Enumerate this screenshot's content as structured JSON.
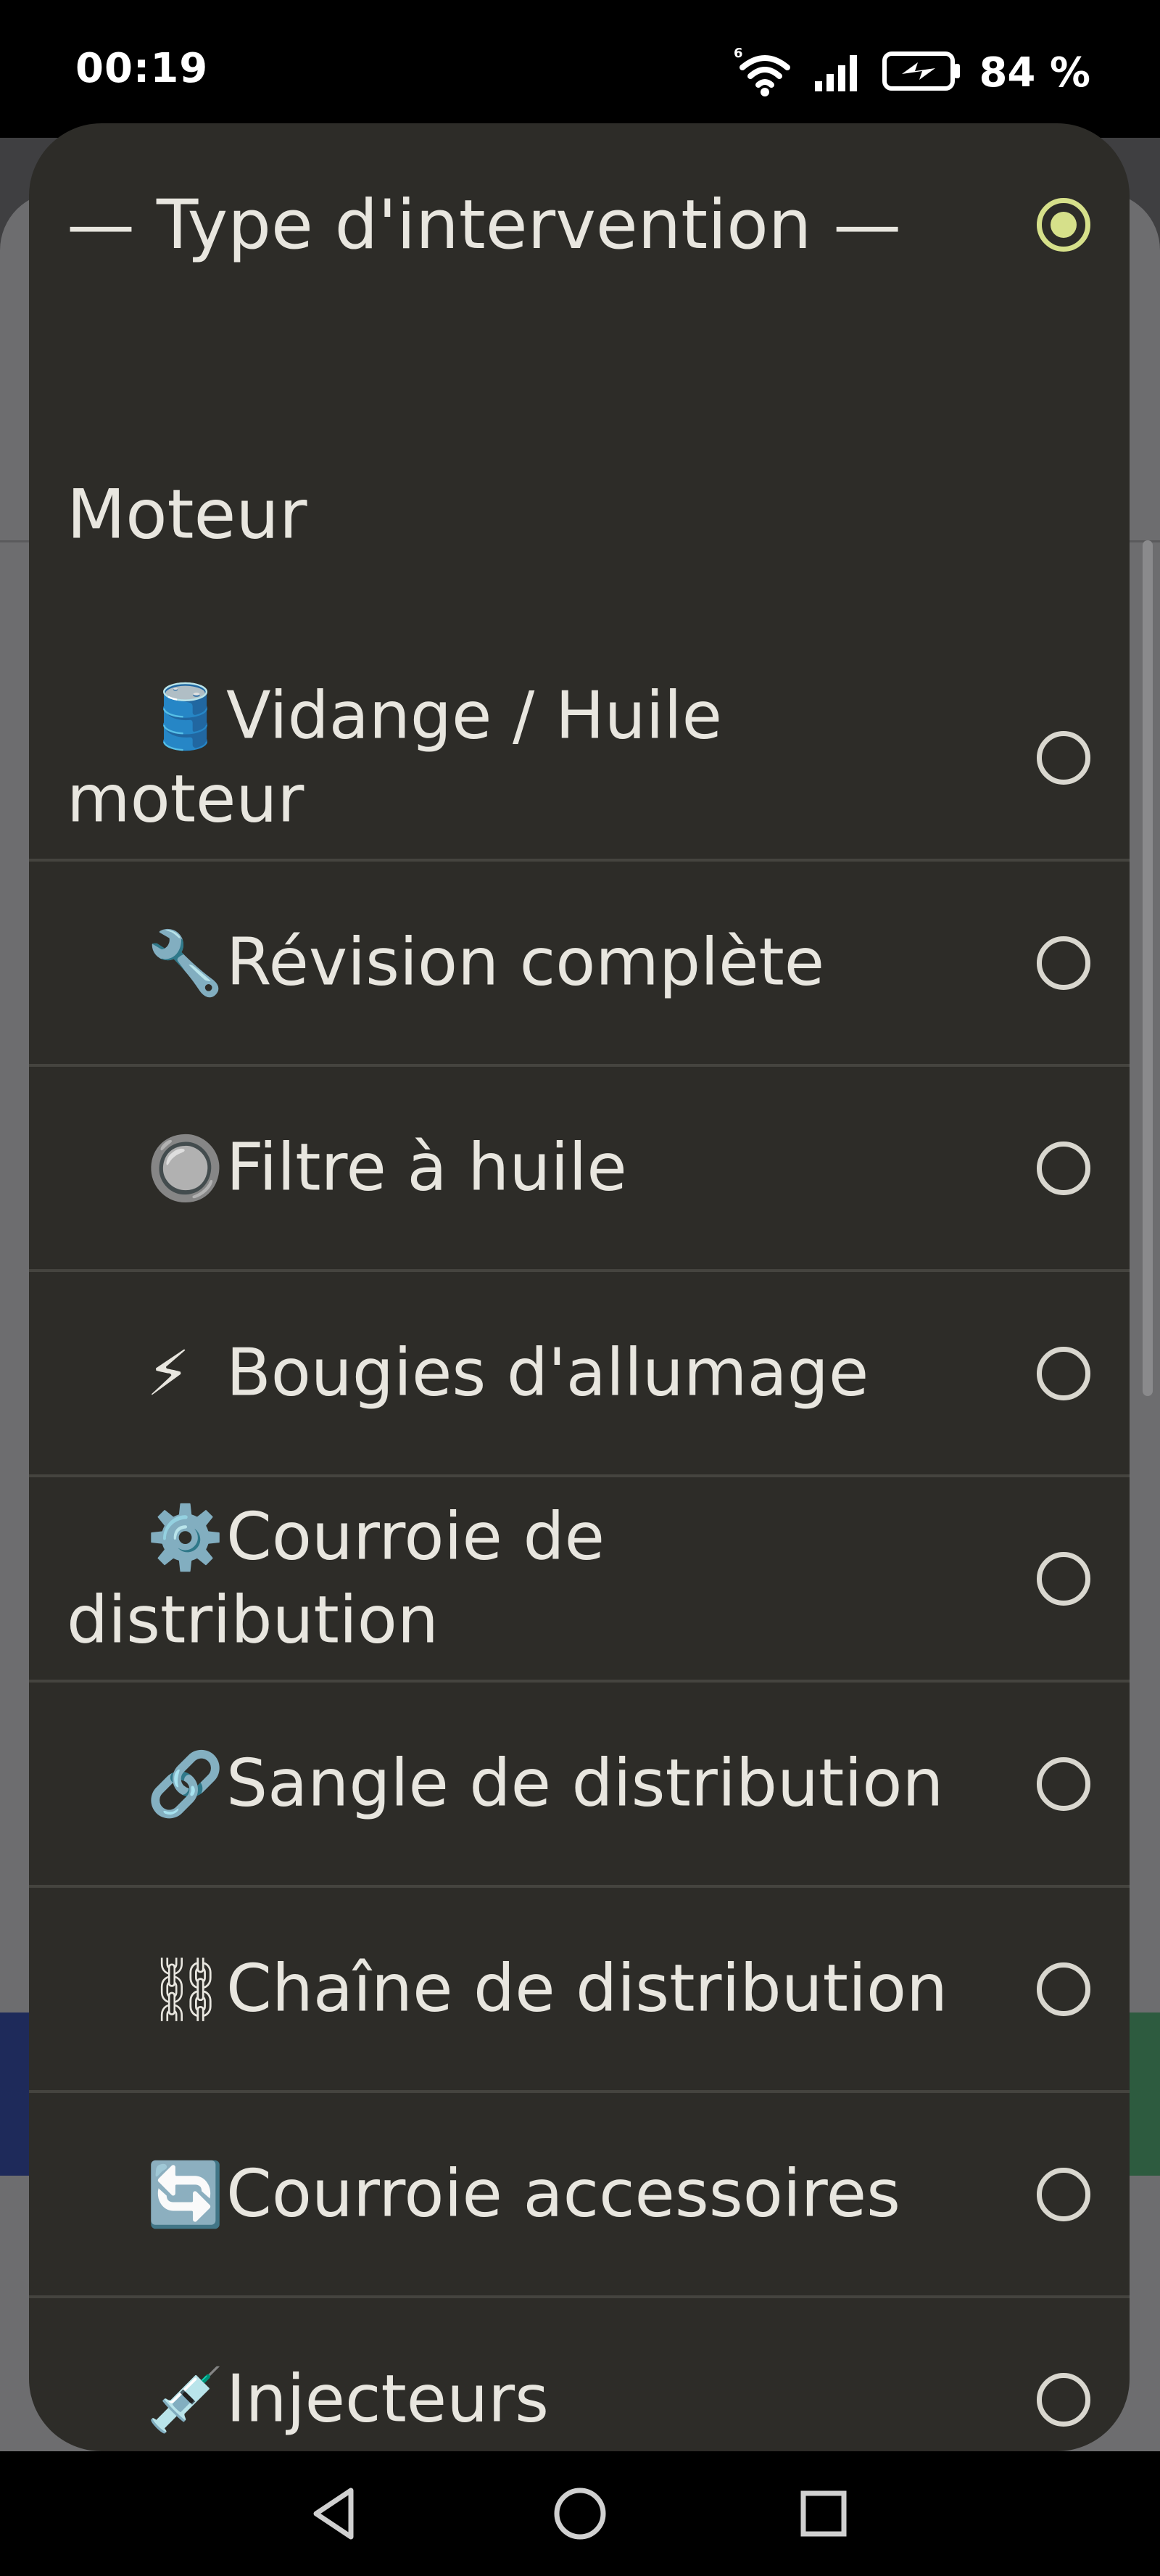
{
  "status_bar": {
    "time": "00:19",
    "battery": "84 %"
  },
  "dialog": {
    "title": "— Type d'intervention —",
    "title_selected": true,
    "group": "Moteur",
    "items": [
      {
        "icon": "🛢️",
        "icon_name": "oil-barrel-icon",
        "label": "Vidange / Huile moteur",
        "selected": false
      },
      {
        "icon": "🔧",
        "icon_name": "wrench-icon",
        "label": "Révision complète",
        "selected": false
      },
      {
        "icon": "🔘",
        "icon_name": "radio-button-icon",
        "label": "Filtre à huile",
        "selected": false
      },
      {
        "icon": "⚡",
        "icon_name": "lightning-icon",
        "label": "Bougies d'allumage",
        "selected": false
      },
      {
        "icon": "⚙️",
        "icon_name": "gear-icon",
        "label": "Courroie de distribution",
        "selected": false
      },
      {
        "icon": "🔗",
        "icon_name": "link-icon",
        "label": "Sangle de distribution",
        "selected": false
      },
      {
        "icon": "⛓",
        "icon_name": "chain-icon",
        "label": "Chaîne de distribution",
        "selected": false
      },
      {
        "icon": "🔄",
        "icon_name": "arrows-cycle-icon",
        "label": "Courroie accessoires",
        "selected": false
      },
      {
        "icon": "💉",
        "icon_name": "syringe-icon",
        "label": "Injecteurs",
        "selected": false
      }
    ]
  },
  "colors": {
    "dialog_bg": "#2d2c28",
    "text": "#e8e6df",
    "accent": "#d6e08a",
    "divider": "#45443f"
  }
}
